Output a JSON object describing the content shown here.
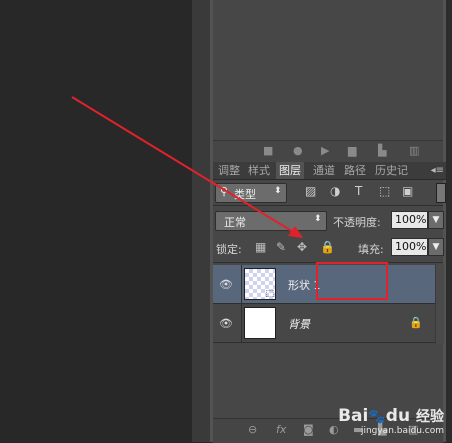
{
  "tabs": [
    "调整",
    "样式",
    "图层",
    "通道",
    "路径",
    "历史记"
  ],
  "active_tab": "图层",
  "filter": {
    "label": "类型"
  },
  "blend": {
    "mode": "正常",
    "opacity_label": "不透明度:",
    "opacity_value": "100%"
  },
  "lock": {
    "label": "锁定:",
    "fill_label": "填充:",
    "fill_value": "100%"
  },
  "layers": [
    {
      "name": "形状 1",
      "selected": true
    },
    {
      "name": "背景",
      "selected": false,
      "locked": true
    }
  ],
  "bottom_icons": [
    "link-icon",
    "fx-icon",
    "mask-icon",
    "adjustment-icon",
    "group-icon",
    "new-layer-icon",
    "delete-icon"
  ],
  "watermark": {
    "brand": "Bai",
    "brand2": "du",
    "suffix": "经验",
    "url": "jingyan.baidu.com"
  },
  "annotation_color": "#e1222a"
}
